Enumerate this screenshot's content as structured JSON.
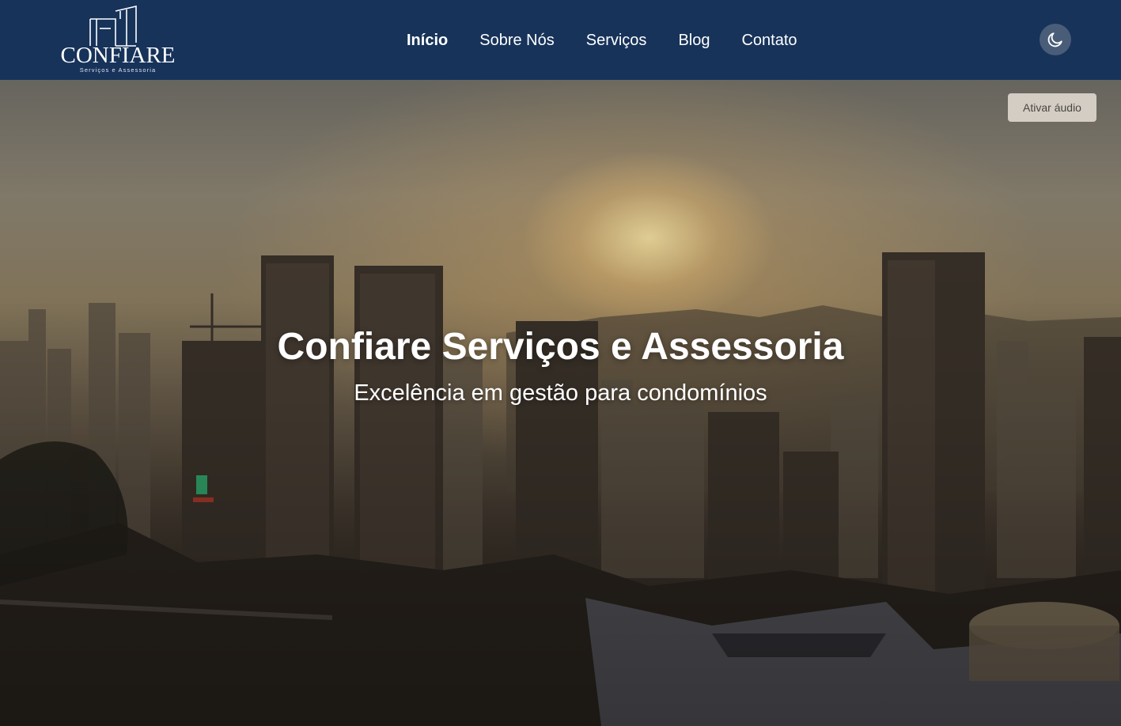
{
  "brand": {
    "name": "CONFIARE",
    "tagline": "Serviços e Assessoria"
  },
  "nav": {
    "items": [
      {
        "label": "Início",
        "active": true
      },
      {
        "label": "Sobre Nós",
        "active": false
      },
      {
        "label": "Serviços",
        "active": false
      },
      {
        "label": "Blog",
        "active": false
      },
      {
        "label": "Contato",
        "active": false
      }
    ]
  },
  "theme_toggle": {
    "icon": "moon-icon"
  },
  "hero": {
    "audio_button": "Ativar áudio",
    "title": "Confiare Serviços e Assessoria",
    "subtitle": "Excelência em gestão para condomínios"
  },
  "colors": {
    "header_bg": "#17335a",
    "toggle_bg": "#4a5d78",
    "text": "#ffffff"
  }
}
